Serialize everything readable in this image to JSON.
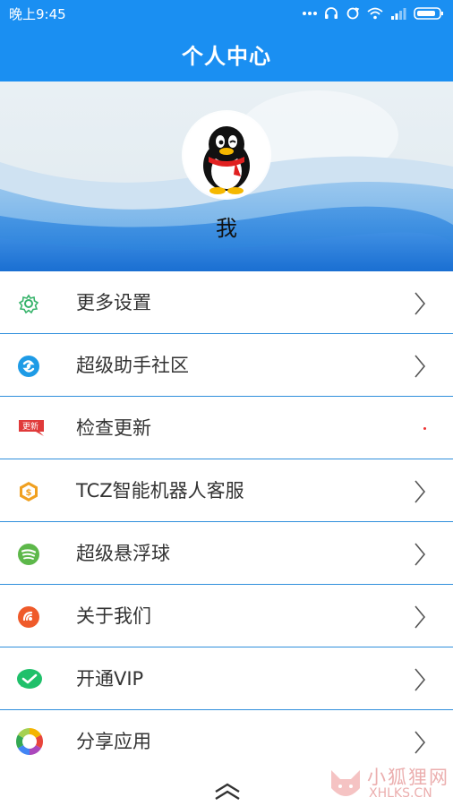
{
  "status_bar": {
    "time": "晚上9:45"
  },
  "header": {
    "title": "个人中心"
  },
  "profile": {
    "username": "我"
  },
  "menu": {
    "items": [
      {
        "label": "更多设置",
        "icon": "gear-icon",
        "color": "#36b36a"
      },
      {
        "label": "超级助手社区",
        "icon": "community-icon",
        "color": "#1e9be6"
      },
      {
        "label": "检查更新",
        "icon": "update-badge-icon",
        "badge": "更新",
        "color": "#e03a3a"
      },
      {
        "label": "TCZ智能机器人客服",
        "icon": "robot-service-icon",
        "color": "#f0a020"
      },
      {
        "label": "超级悬浮球",
        "icon": "floating-ball-icon",
        "color": "#5db84a"
      },
      {
        "label": "关于我们",
        "icon": "about-icon",
        "color": "#ef5a2a"
      },
      {
        "label": "开通VIP",
        "icon": "vip-icon",
        "color": "#1fc06a"
      },
      {
        "label": "分享应用",
        "icon": "share-icon",
        "color": "#f4b400"
      }
    ]
  },
  "watermark": {
    "main": "小狐狸网",
    "sub": "XHLKS.CN"
  },
  "colors": {
    "primary": "#1a8ff2",
    "divider": "#2f8fdc"
  }
}
